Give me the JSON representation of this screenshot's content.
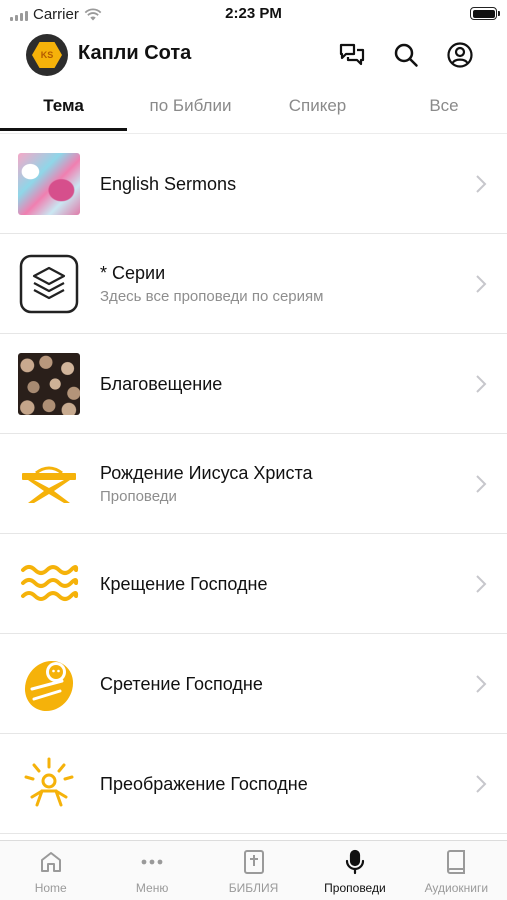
{
  "status_bar": {
    "carrier": "Carrier",
    "time": "2:23 PM"
  },
  "header": {
    "title": "Капли Сота",
    "logo_text": "KS"
  },
  "tabs": [
    {
      "label": "Тема",
      "active": true
    },
    {
      "label": "по Библии",
      "active": false
    },
    {
      "label": "Спикер",
      "active": false
    },
    {
      "label": "Все",
      "active": false
    }
  ],
  "list": [
    {
      "title": "English Sermons",
      "subtitle": "",
      "thumb": "marble-image"
    },
    {
      "title": "* Серии",
      "subtitle": "Здесь все проповеди по сериям",
      "thumb": "layers-icon"
    },
    {
      "title": "Благовещение",
      "subtitle": "",
      "thumb": "logs-image"
    },
    {
      "title": "Рождение Иисуса Христа",
      "subtitle": "Проповеди",
      "thumb": "manger-icon"
    },
    {
      "title": "Крещение Господне",
      "subtitle": "",
      "thumb": "waves-icon"
    },
    {
      "title": "Сретение Господне",
      "subtitle": "",
      "thumb": "baby-icon"
    },
    {
      "title": "Преображение Господне",
      "subtitle": "",
      "thumb": "radiant-figure-icon"
    }
  ],
  "bottom_nav": [
    {
      "label": "Home",
      "icon": "home-icon",
      "active": false
    },
    {
      "label": "Меню",
      "icon": "more-dots-icon",
      "active": false
    },
    {
      "label": "БИБЛИЯ",
      "icon": "bible-icon",
      "active": false
    },
    {
      "label": "Проповеди",
      "icon": "microphone-icon",
      "active": true
    },
    {
      "label": "Аудиокниги",
      "icon": "book-icon",
      "active": false
    }
  ],
  "colors": {
    "accent": "#f5b20a",
    "text": "#111111",
    "muted": "#8e8e8e"
  }
}
